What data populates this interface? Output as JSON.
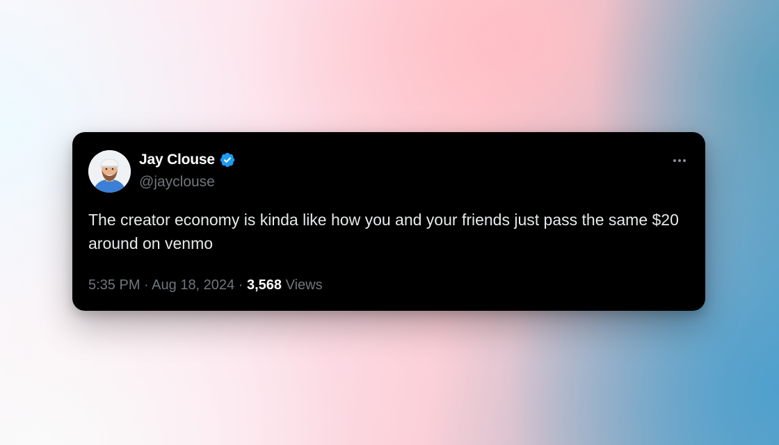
{
  "tweet": {
    "author": {
      "name": "Jay Clouse",
      "handle": "@jayclouse",
      "verified": true,
      "verified_color": "#1d9bf0"
    },
    "text": "The creator economy is kinda like how you and your friends just pass the same $20 around on venmo",
    "time": "5:35 PM",
    "separator": "·",
    "date": "Aug 18, 2024",
    "views_count": "3,568",
    "views_label": "Views",
    "more_icon": "more-horizontal-icon"
  }
}
